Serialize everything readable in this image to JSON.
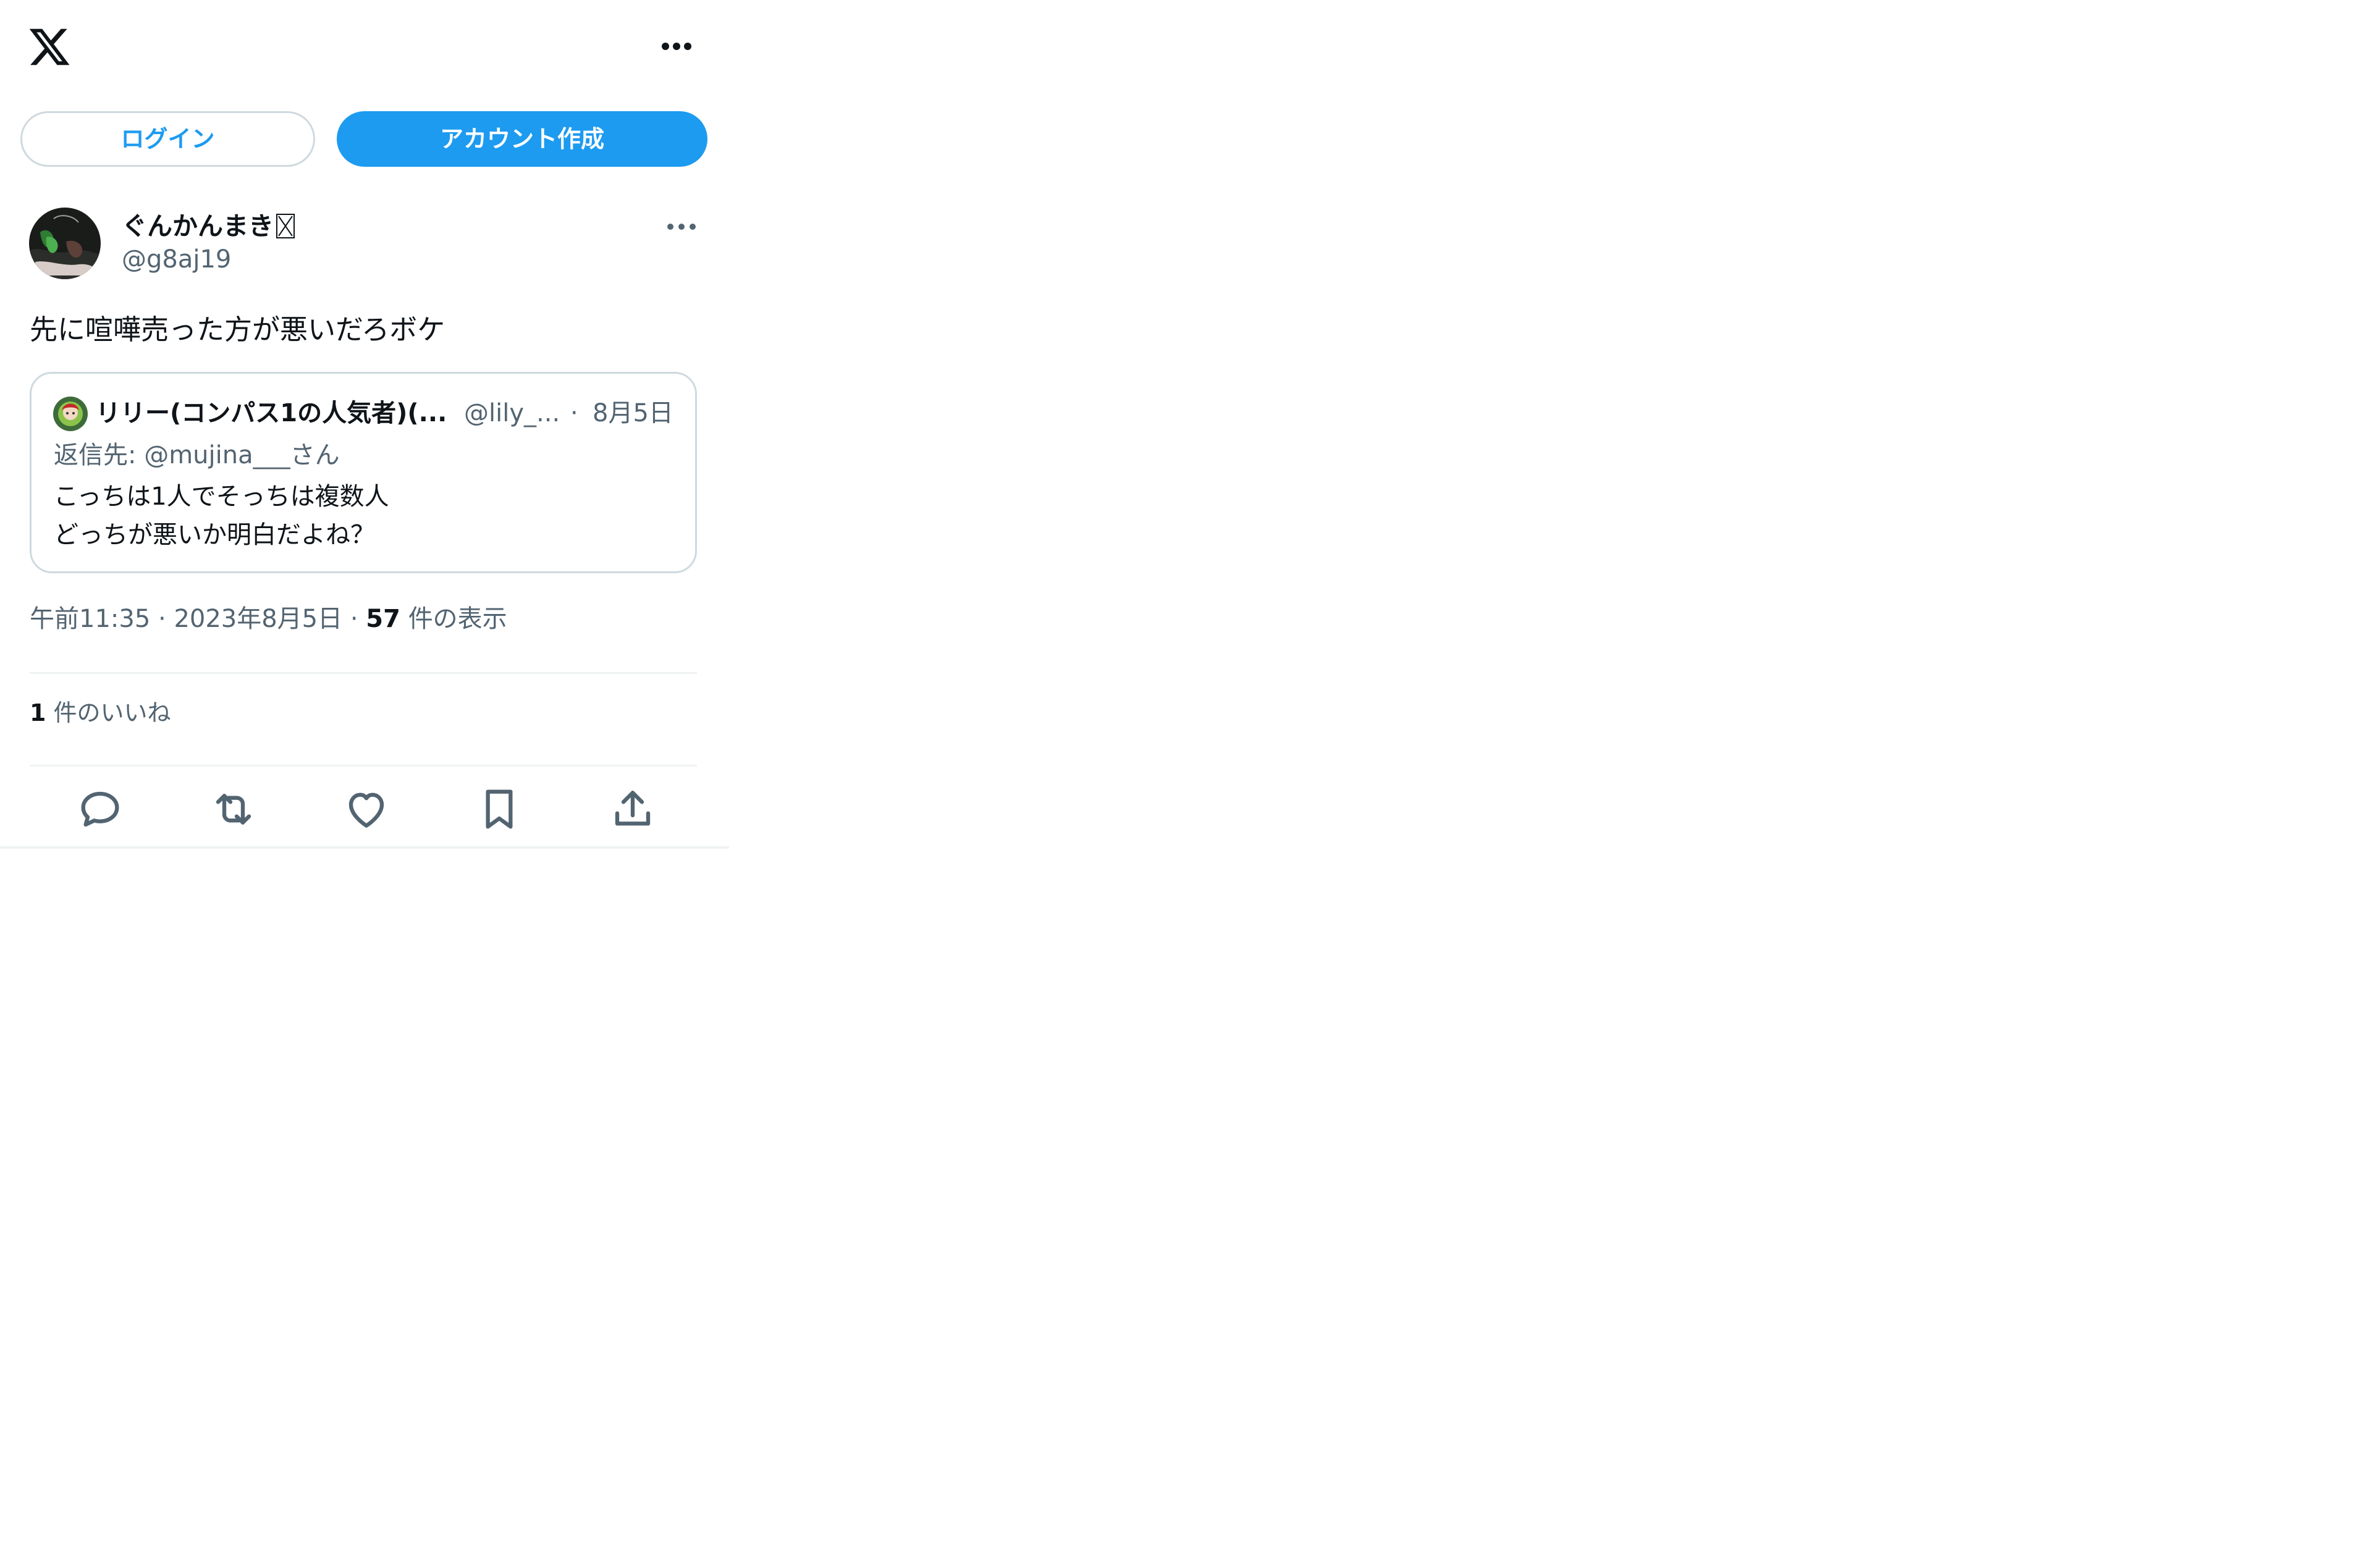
{
  "header": {
    "logo_icon": "x-logo-icon",
    "more_icon": "more-horizontal-icon"
  },
  "auth": {
    "login_label": "ログイン",
    "signup_label": "アカウント作成",
    "accent_color": "#1d9bf0"
  },
  "tweet": {
    "display_name": "ぐんかんまき",
    "handle": "@g8aj19",
    "text": "先に喧嘩売った方が悪いだろボケ",
    "time": "午前11:35",
    "date": "2023年8月5日",
    "view_count": "57",
    "view_label": "件の表示",
    "like_count": "1",
    "like_label": "件のいいね"
  },
  "quote": {
    "display_name": "リリー(コンパス1の人気者)(...",
    "handle": "@lily_...",
    "date": "8月5日",
    "reply_prefix": "返信先:",
    "reply_user": "@mujina___さん",
    "lines": [
      "こっちは1人でそっちは複数人",
      "どっちが悪いか明白だよね？"
    ]
  },
  "actions": [
    {
      "name": "reply",
      "icon": "reply-icon"
    },
    {
      "name": "repost",
      "icon": "repost-icon"
    },
    {
      "name": "like",
      "icon": "heart-icon"
    },
    {
      "name": "bookmark",
      "icon": "bookmark-icon"
    },
    {
      "name": "share",
      "icon": "share-icon"
    }
  ]
}
